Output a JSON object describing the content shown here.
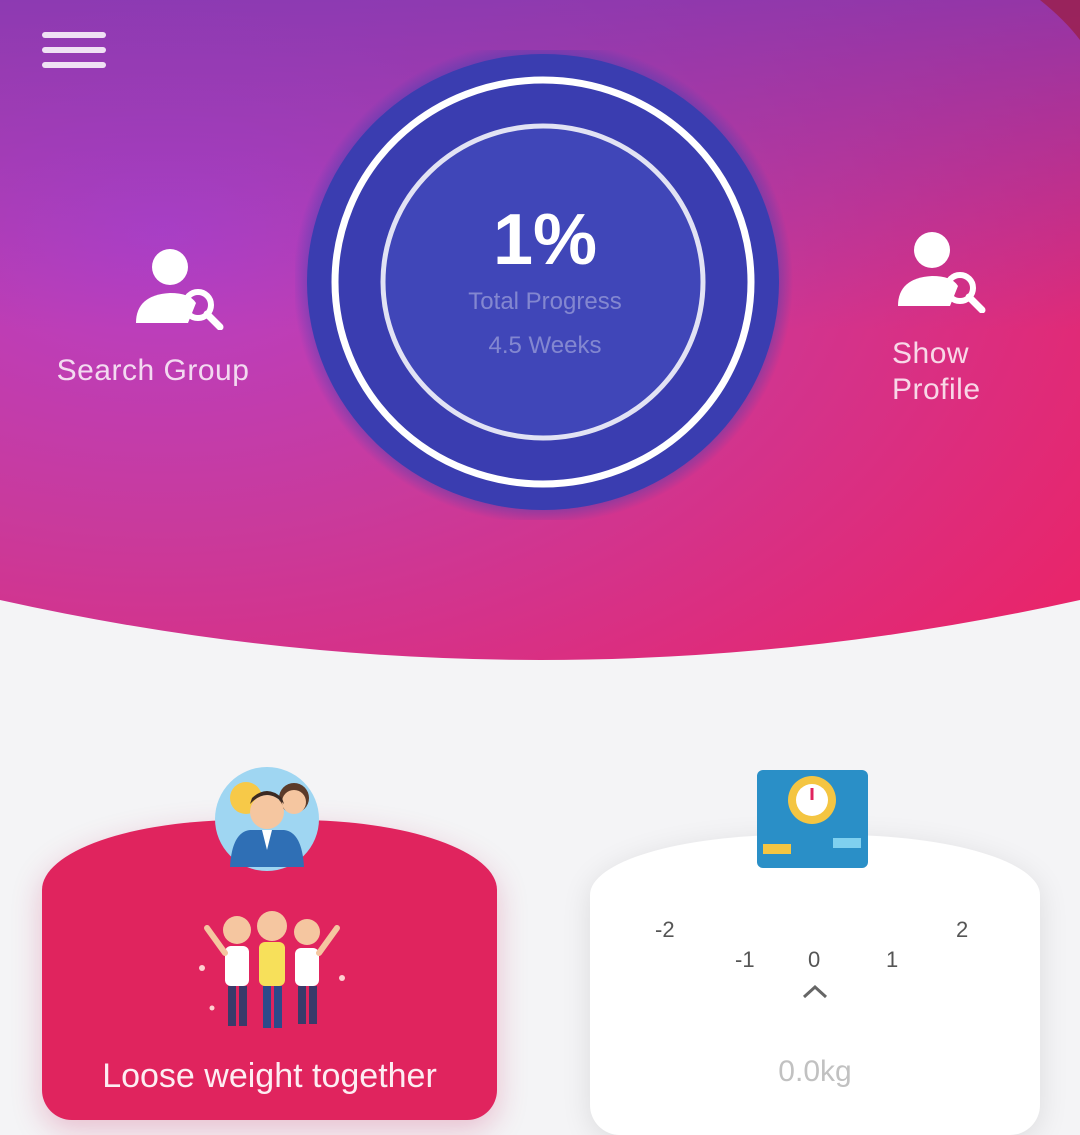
{
  "app": {
    "menu_icon": "hamburger-menu-icon"
  },
  "progress": {
    "percent_label": "1%",
    "total_label": "Total Progress",
    "weeks_label": "4.5 Weeks",
    "ring_color": "#ffffff",
    "inner_color": "#3a3fb0"
  },
  "actions": {
    "search_group": {
      "label": "Search Group",
      "icon": "user-search-icon"
    },
    "show_profile": {
      "label_line1": "Show",
      "label_line2": "Profile",
      "icon": "user-search-icon"
    }
  },
  "cards": {
    "group": {
      "caption": "Loose weight together",
      "icon": "group-avatar-icon",
      "illustration": "cheering-people-illustration",
      "color": "#e0245e"
    },
    "scale": {
      "icon": "weight-scale-icon",
      "ticks": [
        "-2",
        "-1",
        "0",
        "1",
        "2"
      ],
      "value": "0.0kg"
    }
  },
  "colors": {
    "header_gradient_start": "#7b3fc4",
    "header_gradient_mid": "#c03aa8",
    "header_gradient_end": "#e8256e",
    "background": "#f4f4f6"
  }
}
